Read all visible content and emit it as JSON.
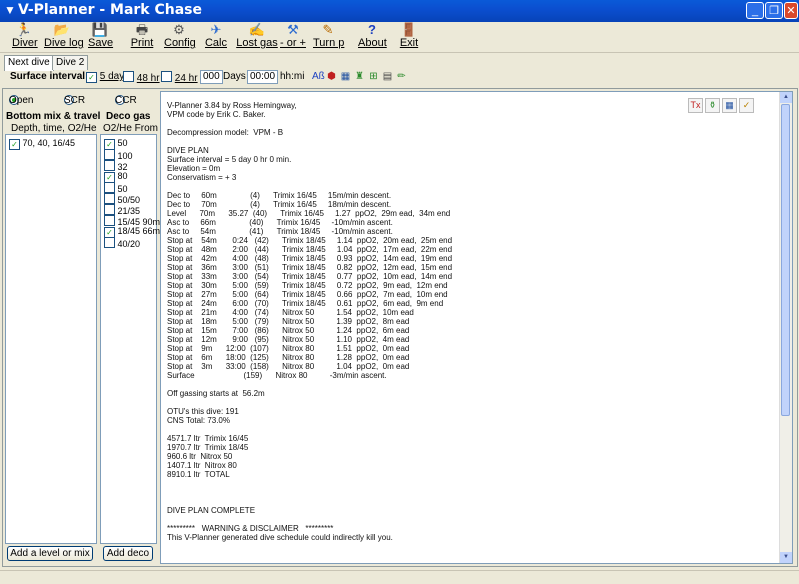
{
  "window": {
    "title": "V-Planner - Mark Chase"
  },
  "toolbar": [
    {
      "key": "diver",
      "label": "Diver",
      "icon": "diver-icon",
      "glyph": "🏃"
    },
    {
      "key": "divelog",
      "label": "Dive log",
      "icon": "dive-log-icon",
      "glyph": "📂"
    },
    {
      "key": "save",
      "label": "Save",
      "icon": "save-icon",
      "glyph": "💾"
    },
    {
      "key": "print",
      "label": "Print",
      "icon": "printer-icon",
      "glyph": "🖶"
    },
    {
      "key": "config",
      "label": "Config",
      "icon": "config-icon",
      "glyph": "⚙"
    },
    {
      "key": "calc",
      "label": "Calc",
      "icon": "calc-icon",
      "glyph": "✈"
    },
    {
      "key": "lostgas",
      "label": "Lost gas",
      "icon": "lost-gas-icon",
      "glyph": "✍"
    },
    {
      "key": "or",
      "label": "- or +",
      "icon": "or-icon",
      "glyph": "⚒"
    },
    {
      "key": "turnp",
      "label": "Turn p",
      "icon": "turn-p-icon",
      "glyph": "✎"
    },
    {
      "key": "about",
      "label": "About",
      "icon": "about-icon",
      "glyph": "?"
    },
    {
      "key": "exit",
      "label": "Exit",
      "icon": "exit-icon",
      "glyph": "🚪"
    }
  ],
  "tabs": [
    "Next dive",
    "Dive 2"
  ],
  "options": {
    "surface_interval_label": "Surface interval",
    "opt_5day": "5 day",
    "opt_48hr": "48 hr",
    "opt_24hr": "24 hr",
    "days_value": "000",
    "days_label": "Days",
    "time_value": "00:00",
    "time_unit": "hh:mi"
  },
  "modes": [
    "Open",
    "SCR",
    "CCR"
  ],
  "bottom": {
    "title": "Bottom mix & travel",
    "subtitle": "Depth, time, O2/He",
    "items": [
      "70, 40, 16/45"
    ],
    "button": "Add a level or mix"
  },
  "deco": {
    "title": "Deco gas",
    "subtitle": "O2/He  From",
    "items": [
      {
        "label": "50",
        "checked": true
      },
      {
        "label": "100",
        "checked": false
      },
      {
        "label": "32",
        "checked": false
      },
      {
        "label": "80",
        "checked": true
      },
      {
        "label": "50",
        "checked": false
      },
      {
        "label": "50/50",
        "checked": false
      },
      {
        "label": "21/35",
        "checked": false
      },
      {
        "label": "15/45 90m",
        "checked": false
      },
      {
        "label": "18/45 66m",
        "checked": true
      },
      {
        "label": "40/20",
        "checked": false
      }
    ],
    "button": "Add deco"
  },
  "plan_text": "V-Planner 3.84 by Ross Hemingway,\nVPM code by Erik C. Baker.\n\nDecompression model:  VPM - B\n\nDIVE PLAN\nSurface interval = 5 day 0 hr 0 min.\nElevation = 0m\nConservatism = + 3\n\nDec to     60m               (4)      Trimix 16/45     15m/min descent.\nDec to     70m               (4)      Trimix 16/45     18m/min descent.\nLevel      70m      35.27  (40)      Trimix 16/45     1.27  ppO2,  29m ead,  34m end\nAsc to     66m               (40)      Trimix 16/45     -10m/min ascent.\nAsc to     54m               (41)      Trimix 18/45     -10m/min ascent.\nStop at    54m       0:24   (42)      Trimix 18/45     1.14  ppO2,  20m ead,  25m end\nStop at    48m       2:00   (44)      Trimix 18/45     1.04  ppO2,  17m ead,  22m end\nStop at    42m       4:00   (48)      Trimix 18/45     0.93  ppO2,  14m ead,  19m end\nStop at    36m       3:00   (51)      Trimix 18/45     0.82  ppO2,  12m ead,  15m end\nStop at    33m       3:00   (54)      Trimix 18/45     0.77  ppO2,  10m ead,  14m end\nStop at    30m       5:00   (59)      Trimix 18/45     0.72  ppO2,  9m ead,  12m end\nStop at    27m       5:00   (64)      Trimix 18/45     0.66  ppO2,  7m ead,  10m end\nStop at    24m       6:00   (70)      Trimix 18/45     0.61  ppO2,  6m ead,  9m end\nStop at    21m       4:00   (74)      Nitrox 50          1.54  ppO2,  10m ead\nStop at    18m       5:00   (79)      Nitrox 50          1.39  ppO2,  8m ead\nStop at    15m       7:00   (86)      Nitrox 50          1.24  ppO2,  6m ead\nStop at    12m       9:00   (95)      Nitrox 50          1.10  ppO2,  4m ead\nStop at    9m      12:00  (107)      Nitrox 80          1.51  ppO2,  0m ead\nStop at    6m      18:00  (125)      Nitrox 80          1.28  ppO2,  0m ead\nStop at    3m      33:00  (158)      Nitrox 80          1.04  ppO2,  0m ead\nSurface                      (159)      Nitrox 80          -3m/min ascent.\n\nOff gassing starts at  56.2m\n\nOTU's this dive: 191\nCNS Total: 73.0%\n\n4571.7 ltr  Trimix 16/45\n1970.7 ltr  Trimix 18/45\n960.6 ltr  Nitrox 50\n1407.1 ltr  Nitrox 80\n8910.1 ltr  TOTAL\n\n\n\nDIVE PLAN COMPLETE\n\n*********   WARNING & DISCLAIMER   *********\nThis V-Planner generated dive schedule could indirectly kill you."
}
